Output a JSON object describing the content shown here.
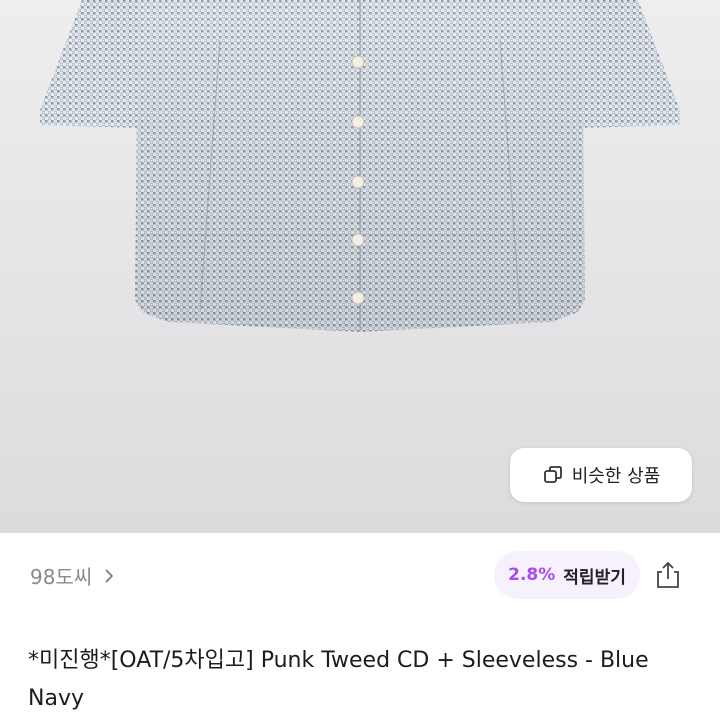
{
  "photo": {
    "similar_button": {
      "label": "비슷한 상품",
      "icon": "copy-icon"
    }
  },
  "store": {
    "name": "98도씨",
    "chevron_icon": "chevron-right-icon"
  },
  "points": {
    "rate": "2.8%",
    "label": "적립받기",
    "accent_color": "#a84bf0"
  },
  "share": {
    "icon": "share-icon"
  },
  "product": {
    "title": "*미진행*[OAT/5차입고] Punk Tweed CD + Sleeveless - Blue Navy"
  }
}
